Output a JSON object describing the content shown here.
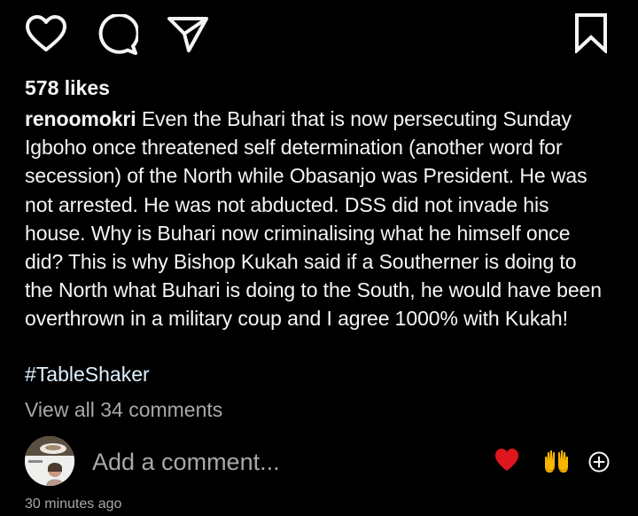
{
  "actions": {
    "like_icon": "heart-outline-icon",
    "comment_icon": "speech-bubble-icon",
    "share_icon": "paper-plane-icon",
    "save_icon": "bookmark-icon"
  },
  "post": {
    "likes_text": "578 likes",
    "username": "renoomokri",
    "caption_lines": [
      " Even the Buhari that is now persecuting Sunday",
      "Igboho once threatened self determination (another word for",
      "secession) of the North while Obasanjo was President. He was",
      "not arrested. He was not abducted. DSS did not invade his",
      "house. Why is Buhari now criminalising what he himself once",
      "did? This is why Bishop Kukah said if a Southerner is doing to",
      "the North what Buhari is doing to the South, he would have been",
      "overthrown in a military coup and I agree 1000% with Kukah!"
    ],
    "hashtag": "#TableShaker",
    "view_comments_text": "View all 34 comments",
    "timestamp": "30 minutes ago"
  },
  "comment_bar": {
    "placeholder": "Add a comment...",
    "quick_reactions": [
      "❤️",
      "🙌"
    ],
    "add_emoji_icon": "plus-circle-icon"
  },
  "colors": {
    "background": "#000000",
    "text": "#f5f5f5",
    "secondary_text": "#a8a8a8",
    "hashtag": "#e0f1ff",
    "heart_red": "#e0161e",
    "clap_yellow": "#f7b500"
  }
}
